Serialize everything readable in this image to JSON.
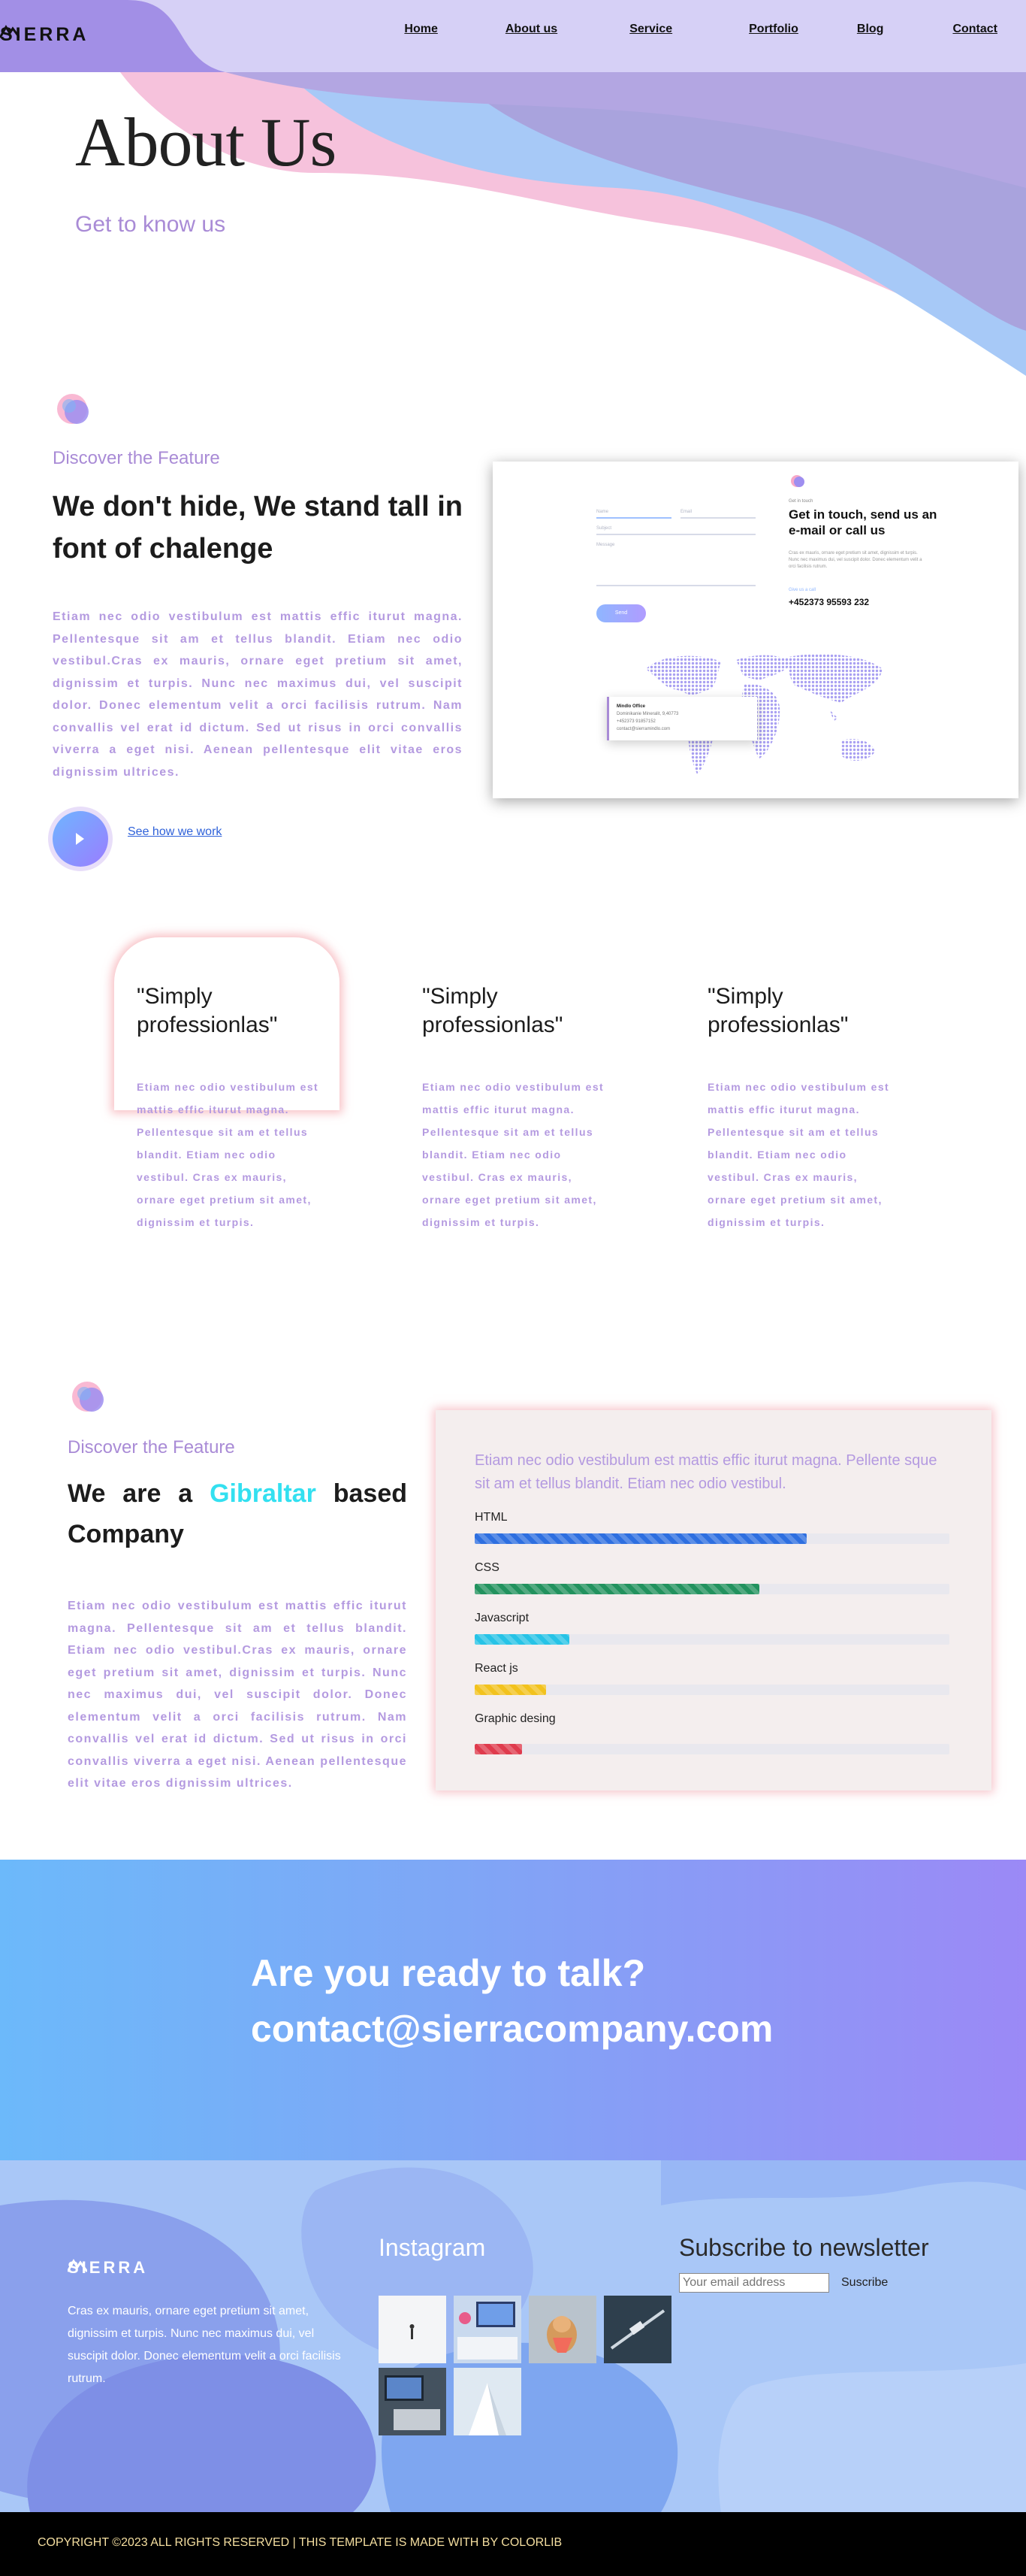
{
  "brand": {
    "name": "SIERRA"
  },
  "nav": {
    "items": [
      "Home",
      "About us",
      "Service",
      "Portfolio",
      "Blog",
      "Contact"
    ]
  },
  "hero": {
    "title": "About Us",
    "subtitle": "Get to know us"
  },
  "feature1": {
    "kicker": "Discover the Feature",
    "title": "We don't hide, We stand tall in font of chalenge",
    "body": "Etiam nec odio vestibulum est mattis effic iturut magna. Pellentesque sit am et tellus blandit. Etiam nec odio vestibul.Cras ex mauris, ornare eget pretium sit amet, dignissim et turpis. Nunc nec maximus dui, vel suscipit dolor. Donec elementum velit a orci facilisis rutrum. Nam convallis vel erat id dictum. Sed ut risus in orci convallis viverra a eget nisi. Aenean pellentesque elit vitae eros dignissim ultrices.",
    "link": "See how we work"
  },
  "contact_mock": {
    "small": "Get in touch",
    "title": "Get in touch, send us an e-mail or call us",
    "para": "Cras ex mauris, ornare eget pretium sit amet, dignissim et turpis. Nunc nec maximus dui, vel suscipit dolor. Donec elementum velit a orci facilisis rutrum.",
    "label": "Give us a call",
    "phone": "+452373 95593 232",
    "send": "Send",
    "office_title": "Mindlo Office",
    "office_line1": "Dominikanie Mineralit, 9,40773",
    "office_line2": "+452373 91857152",
    "office_line3": "contact@sierramindlo.com"
  },
  "cards": [
    {
      "quote": "\"Simply professionlas\"",
      "text": "Etiam nec odio vestibulum est mattis effic iturut magna. Pellentesque sit am et tellus blandit. Etiam nec odio vestibul. Cras ex mauris, ornare eget pretium sit amet, dignissim et turpis."
    },
    {
      "quote": "\"Simply professionlas\"",
      "text": "Etiam nec odio vestibulum est mattis effic iturut magna. Pellentesque sit am et tellus blandit. Etiam nec odio vestibul. Cras ex mauris, ornare eget pretium sit amet, dignissim et turpis."
    },
    {
      "quote": "\"Simply professionlas\"",
      "text": "Etiam nec odio vestibulum est mattis effic iturut magna. Pellentesque sit am et tellus blandit. Etiam nec odio vestibul. Cras ex mauris, ornare eget pretium sit amet, dignissim et turpis."
    }
  ],
  "feature2": {
    "kicker": "Discover the Feature",
    "title_pre": "We are a",
    "title_highlight": "Gibraltar",
    "title_post": "based Company",
    "body": "Etiam nec odio vestibulum est mattis effic iturut magna. Pellentesque sit am et tellus blandit. Etiam nec odio vestibul.Cras ex mauris, ornare eget pretium sit amet, dignissim et turpis. Nunc nec maximus dui, vel suscipit dolor. Donec elementum velit a orci facilisis rutrum. Nam convallis vel erat id dictum. Sed ut risus in orci convallis viverra a eget nisi. Aenean pellentesque elit vitae eros dignissim ultrices."
  },
  "skills": {
    "intro": "Etiam nec odio vestibulum est mattis effic iturut magna. Pellente sque sit am et tellus blandit. Etiam nec odio vestibul.",
    "items": [
      {
        "name": "HTML",
        "level": 0.7,
        "color": "#2e6fe0"
      },
      {
        "name": "CSS",
        "level": 0.6,
        "color": "#22925e"
      },
      {
        "name": "Javascript",
        "level": 0.2,
        "color": "#27c3e6"
      },
      {
        "name": "React js",
        "level": 0.15,
        "color": "#f2c21e"
      },
      {
        "name": "Graphic desing",
        "level": 0.1,
        "color": "#df3b4d"
      }
    ]
  },
  "cta": {
    "line1": "Are you ready to talk?",
    "line2": "contact@sierracompany.com"
  },
  "footer": {
    "about": "Cras ex mauris, ornare eget pretium sit amet, dignissim et turpis. Nunc nec maximus dui, vel suscipit dolor. Donec elementum velit a orci facilisis rutrum.",
    "instagram_title": "Instagram",
    "newsletter_title": "Subscribe to newsletter",
    "email_placeholder": "Your email address",
    "subscribe_label": "Suscribe",
    "copyright": "COPYRIGHT ©2023 ALL RIGHTS RESERVED | THIS TEMPLATE IS MADE WITH BY COLORLIB"
  },
  "colors": {
    "accent_purple": "#a98bd6",
    "highlight_cyan": "#33e0f0",
    "link_blue": "#2e61d9"
  }
}
